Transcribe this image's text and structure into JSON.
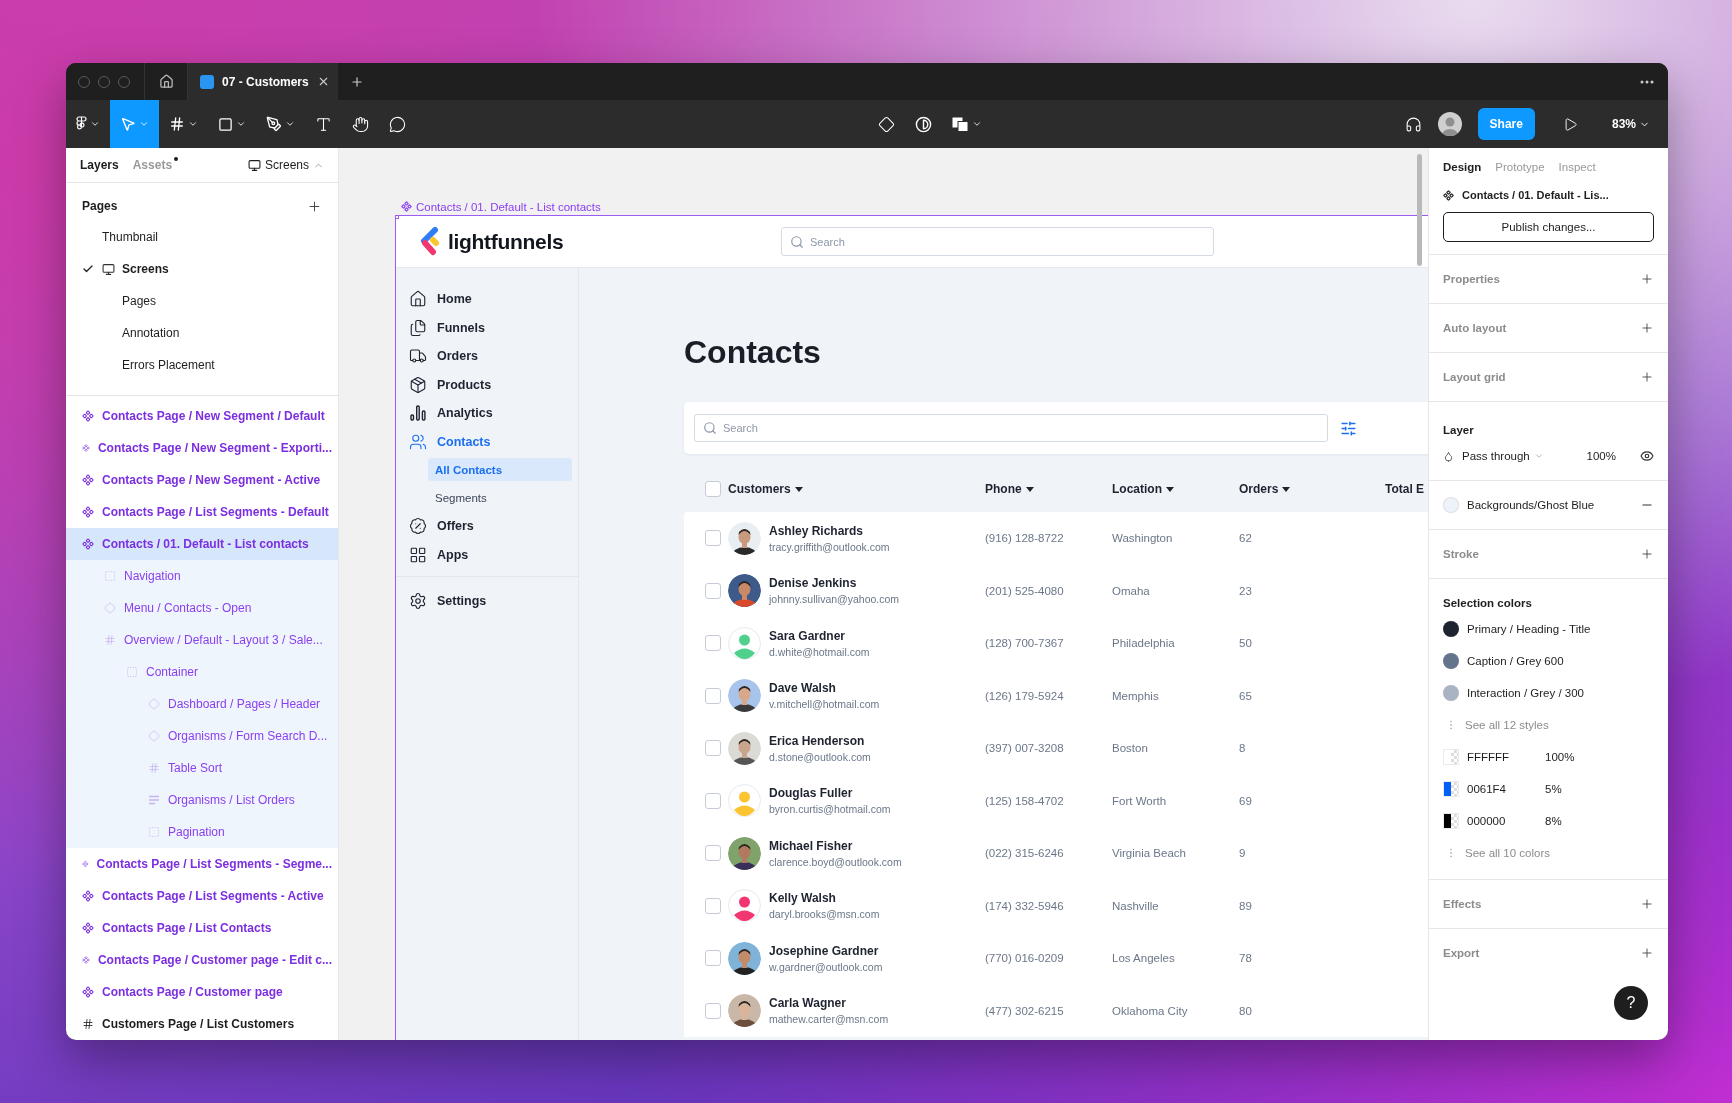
{
  "window": {
    "tab_title": "07 - Customers"
  },
  "toolbar": {
    "tools": [
      {
        "selected": false
      },
      {
        "selected": true
      },
      {
        "selected": false
      },
      {
        "selected": false
      },
      {
        "selected": false
      },
      {
        "selected": false
      },
      {
        "selected": false
      },
      {
        "selected": false
      }
    ],
    "share": "Share",
    "zoom": "83%"
  },
  "left_panel": {
    "tabs": [
      {
        "label": "Layers",
        "selected": true
      },
      {
        "label": "Assets",
        "selected": false,
        "unread": true
      }
    ],
    "page_switcher": "Screens",
    "pages_title": "Pages",
    "pages": [
      {
        "label": "Thumbnail",
        "current": false,
        "kind": "plain"
      },
      {
        "label": "Screens",
        "current": true,
        "kind": "monitor"
      },
      {
        "label": "Pages",
        "current": false,
        "kind": "spaced"
      },
      {
        "label": "Annotation",
        "current": false,
        "kind": "spaced"
      },
      {
        "label": "Errors Placement",
        "current": false,
        "kind": "spaced"
      }
    ],
    "layers": [
      {
        "label": "Contacts Page / New Segment / Default",
        "kind": "component",
        "selected": false
      },
      {
        "label": "Contacts Page / New Segment - Exporti...",
        "kind": "component",
        "selected": false
      },
      {
        "label": "Contacts Page / New Segment - Active",
        "kind": "component",
        "selected": false
      },
      {
        "label": "Contacts Page / List Segments - Default",
        "kind": "component",
        "selected": false
      },
      {
        "label": "Contacts / 01. Default - List contacts",
        "kind": "component",
        "selected": true,
        "children": [
          {
            "label": "Navigation",
            "kind": "group",
            "selected": false
          },
          {
            "label": "Menu / Contacts - Open",
            "kind": "instance",
            "selected": false
          },
          {
            "label": "Overview / Default - Layout 3 / Sale...",
            "kind": "frame",
            "selected": false,
            "children": [
              {
                "label": "Container",
                "kind": "group",
                "selected": false,
                "children": [
                  {
                    "label": "Dashboard / Pages / Header",
                    "kind": "instance",
                    "selected": false
                  },
                  {
                    "label": "Organisms / Form Search D...",
                    "kind": "instance",
                    "selected": false
                  },
                  {
                    "label": "Table Sort",
                    "kind": "frame",
                    "selected": false
                  },
                  {
                    "label": "Organisms / List Orders",
                    "kind": "list",
                    "selected": false
                  },
                  {
                    "label": "Pagination",
                    "kind": "group",
                    "selected": false
                  }
                ]
              }
            ]
          }
        ]
      },
      {
        "label": "Contacts Page / List Segments - Segme...",
        "kind": "component",
        "selected": false
      },
      {
        "label": "Contacts Page / List Segments - Active",
        "kind": "component",
        "selected": false
      },
      {
        "label": "Contacts Page / List Contacts",
        "kind": "component",
        "selected": false
      },
      {
        "label": "Contacts Page / Customer page - Edit c...",
        "kind": "component",
        "selected": false
      },
      {
        "label": "Contacts Page / Customer page",
        "kind": "component",
        "selected": false
      },
      {
        "label": "Customers Page / List Customers",
        "kind": "frame",
        "selected": false
      }
    ]
  },
  "canvas": {
    "frame_label": "Contacts / 01. Default - List contacts",
    "app": {
      "logo": "lightfunnels",
      "header_search": {
        "placeholder": "Search"
      },
      "nav": [
        {
          "label": "Home",
          "selected": false
        },
        {
          "label": "Funnels",
          "selected": false
        },
        {
          "label": "Orders",
          "selected": false
        },
        {
          "label": "Products",
          "selected": false
        },
        {
          "label": "Analytics",
          "selected": false
        },
        {
          "label": "Contacts",
          "selected": true,
          "children": [
            {
              "label": "All Contacts",
              "selected": true
            },
            {
              "label": "Segments",
              "selected": false
            }
          ]
        },
        {
          "label": "Offers",
          "selected": false
        },
        {
          "label": "Apps",
          "selected": false
        }
      ],
      "nav_bottom": [
        {
          "label": "Settings",
          "selected": false
        }
      ],
      "title": "Contacts",
      "search": {
        "placeholder": "Search"
      },
      "table": {
        "all_checked": false,
        "columns": [
          "Customers",
          "Phone",
          "Location",
          "Orders",
          "Total E"
        ],
        "rows": [
          {
            "name": "Ashley Richards",
            "email": "tracy.griffith@outlook.com",
            "phone": "(916) 128-8722",
            "location": "Washington",
            "orders": "62",
            "checked": false
          },
          {
            "name": "Denise Jenkins",
            "email": "johnny.sullivan@yahoo.com",
            "phone": "(201) 525-4080",
            "location": "Omaha",
            "orders": "23",
            "checked": false
          },
          {
            "name": "Sara Gardner",
            "email": "d.white@hotmail.com",
            "phone": "(128) 700-7367",
            "location": "Philadelphia",
            "orders": "50",
            "checked": false,
            "avatar": {
              "kind": "placeholder",
              "color": "#4fd18b"
            }
          },
          {
            "name": "Dave Walsh",
            "email": "v.mitchell@hotmail.com",
            "phone": "(126) 179-5924",
            "location": "Memphis",
            "orders": "65",
            "checked": false
          },
          {
            "name": "Erica Henderson",
            "email": "d.stone@outlook.com",
            "phone": "(397) 007-3208",
            "location": "Boston",
            "orders": "8",
            "checked": false
          },
          {
            "name": "Douglas Fuller",
            "email": "byron.curtis@hotmail.com",
            "phone": "(125) 158-4702",
            "location": "Fort Worth",
            "orders": "69",
            "checked": false,
            "avatar": {
              "kind": "placeholder",
              "color": "#fbc531"
            }
          },
          {
            "name": "Michael Fisher",
            "email": "clarence.boyd@outlook.com",
            "phone": "(022) 315-6246",
            "location": "Virginia Beach",
            "orders": "9",
            "checked": false
          },
          {
            "name": "Kelly Walsh",
            "email": "daryl.brooks@msn.com",
            "phone": "(174) 332-5946",
            "location": "Nashville",
            "orders": "89",
            "checked": false,
            "avatar": {
              "kind": "placeholder",
              "color": "#f0376f"
            }
          },
          {
            "name": "Josephine Gardner",
            "email": "w.gardner@outlook.com",
            "phone": "(770) 016-0209",
            "location": "Los Angeles",
            "orders": "78",
            "checked": false
          },
          {
            "name": "Carla Wagner",
            "email": "mathew.carter@msn.com",
            "phone": "(477) 302-6215",
            "location": "Oklahoma City",
            "orders": "80",
            "checked": false
          }
        ]
      }
    }
  },
  "right_panel": {
    "tabs": [
      {
        "label": "Design",
        "selected": true
      },
      {
        "label": "Prototype",
        "selected": false
      },
      {
        "label": "Inspect",
        "selected": false
      }
    ],
    "component_name": "Contacts / 01. Default - Lis...",
    "publish_button": "Publish changes...",
    "sections": [
      {
        "kind": "empty",
        "title": "Properties"
      },
      {
        "kind": "empty",
        "title": "Auto layout"
      },
      {
        "kind": "empty",
        "title": "Layout grid"
      },
      {
        "kind": "layer",
        "title": "Layer",
        "blend": "Pass through",
        "opacity": "100%",
        "visible": true
      },
      {
        "kind": "fill",
        "style": "Backgrounds/Ghost Blue",
        "color": "#eef2f9"
      },
      {
        "kind": "empty",
        "title": "Stroke"
      },
      {
        "kind": "colors",
        "title": "Selection colors",
        "styles": [
          {
            "name": "Primary / Heading - Title",
            "color": "#1e2330"
          },
          {
            "name": "Caption / Grey 600",
            "color": "#64748b"
          },
          {
            "name": "Interaction / Grey / 300",
            "color": "#a9b3c4"
          }
        ],
        "styles_link": "See all 12 styles",
        "colors": [
          {
            "hex": "FFFFFF",
            "opacity": "100%",
            "color": "#ffffff"
          },
          {
            "hex": "0061F4",
            "opacity": "5%",
            "color": "#0061f4"
          },
          {
            "hex": "000000",
            "opacity": "8%",
            "color": "#000000"
          }
        ],
        "colors_link": "See all 10 colors"
      },
      {
        "kind": "empty",
        "title": "Effects"
      },
      {
        "kind": "empty",
        "title": "Export"
      }
    ],
    "help": "?"
  }
}
